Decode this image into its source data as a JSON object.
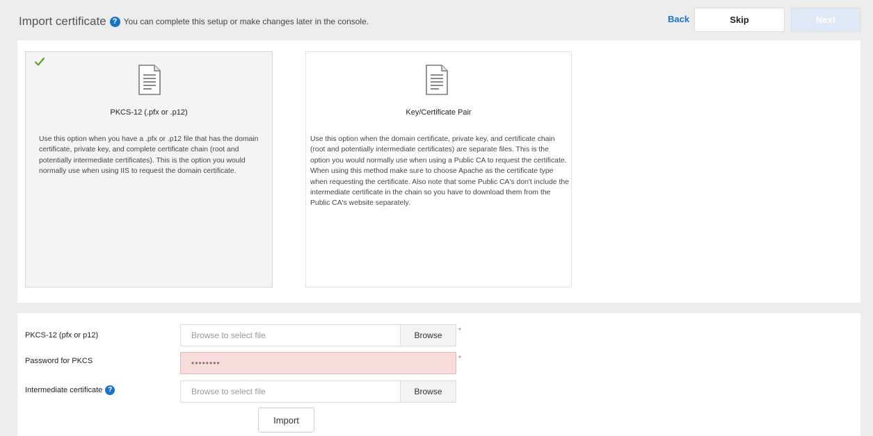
{
  "header": {
    "title": "Import certificate",
    "help_glyph": "?",
    "subtitle": "You can complete this setup or make changes later in the console.",
    "back_label": "Back",
    "skip_label": "Skip",
    "next_label": "Next",
    "next_disabled": true
  },
  "options": [
    {
      "icon": "document-icon",
      "selected": true,
      "check_icon": "checkmark-icon",
      "title": "PKCS-12 (.pfx or .p12)",
      "description": "Use this option when you have a .pfx or .p12 file that has the domain certificate, private key, and complete certificate chain (root and potentially intermediate certificates). This is the option you would normally use when using IIS to request the domain certificate."
    },
    {
      "icon": "document-icon",
      "selected": false,
      "title": "Key/Certificate Pair",
      "description": "Use this option when the domain certificate, private key, and certificate chain (root and potentially intermediate certificates) are separate files. This is the option you would normally use when using a Public CA to request the certificate. When using this method make sure to choose Apache as the certificate type when requesting the certificate. Also note that some Public CA's don't include the intermediate certificate in the chain so you have to download them from the Public CA's website separately."
    }
  ],
  "form": {
    "pkcs_label": "PKCS-12 (pfx or p12)",
    "pkcs_placeholder": "Browse to select file",
    "pkcs_browse": "Browse",
    "password_label": "Password for PKCS",
    "password_value": "••••••••",
    "intermediate_label": "Intermediate certificate",
    "intermediate_placeholder": "Browse to select file",
    "intermediate_browse": "Browse",
    "required_mark": "*",
    "import_label": "Import"
  },
  "colors": {
    "accent": "#1a73c8",
    "check": "#5a9e2c",
    "error_bg": "#f8dcdc",
    "required": "#d9534f"
  }
}
